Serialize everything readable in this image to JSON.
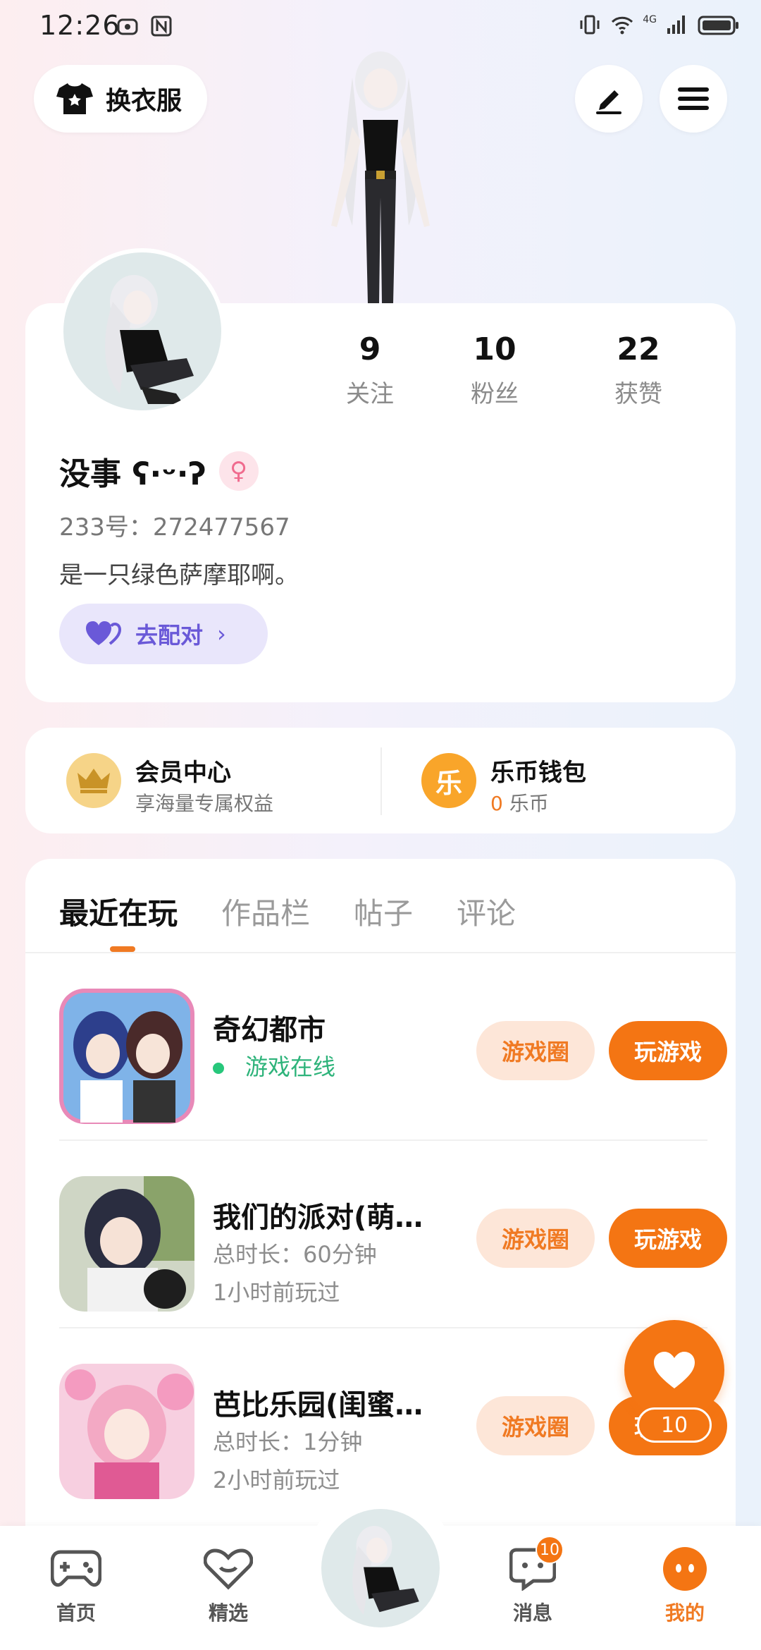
{
  "status_bar": {
    "time": "12:26",
    "network": "4G"
  },
  "top": {
    "outfit_label": "换衣服"
  },
  "profile": {
    "stats": [
      {
        "value": "9",
        "label": "关注"
      },
      {
        "value": "10",
        "label": "粉丝"
      },
      {
        "value": "22",
        "label": "获赞"
      }
    ],
    "name": "没事 ʕ·ᵕ·ʔ",
    "gender_symbol": "♀",
    "uid": "233号：272477567",
    "bio": "是一只绿色萨摩耶啊。",
    "match_label": "去配对"
  },
  "member": {
    "title": "会员中心",
    "subtitle": "享海量专属权益"
  },
  "wallet": {
    "title": "乐币钱包",
    "coin_char": "乐",
    "amount": "0",
    "unit": " 乐币"
  },
  "tabs": [
    "最近在玩",
    "作品栏",
    "帖子",
    "评论"
  ],
  "games": [
    {
      "name": "奇幻都市",
      "status": "游戏在线",
      "circle_label": "游戏圈",
      "play_label": "玩游戏"
    },
    {
      "name": "我们的派对(萌…",
      "duration": "总时长：60分钟",
      "last_played": "1小时前玩过",
      "circle_label": "游戏圈",
      "play_label": "玩游戏"
    },
    {
      "name": "芭比乐园(闺蜜…",
      "duration": "总时长：1分钟",
      "last_played": "2小时前玩过",
      "circle_label": "游戏圈",
      "play_label": "玩游戏"
    }
  ],
  "float_like": {
    "count": "10"
  },
  "nav": {
    "home": "首页",
    "featured": "精选",
    "messages": "消息",
    "messages_badge": "10",
    "me": "我的"
  },
  "colors": {
    "accent": "#f47513",
    "match": "#6a59d8",
    "online": "#27c77b"
  }
}
